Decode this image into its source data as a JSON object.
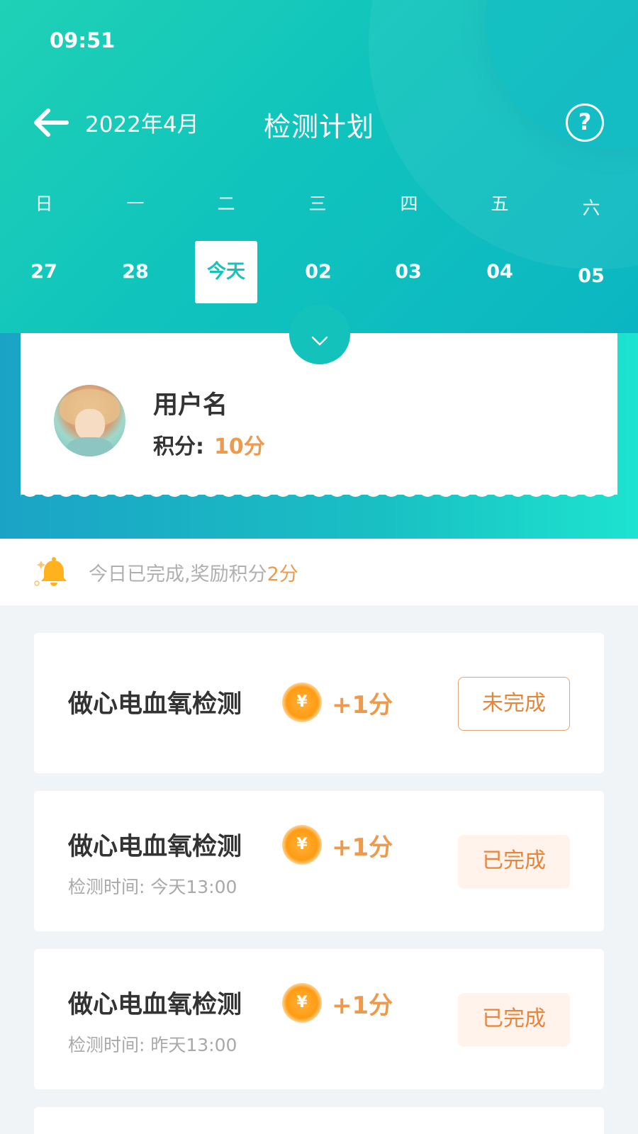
{
  "status_bar": {
    "time": "09:51"
  },
  "header": {
    "month": "2022年4月",
    "title": "检测计划",
    "help_icon": "question-circle-icon",
    "back_icon": "arrow-left-icon"
  },
  "calendar": {
    "weekdays": [
      "日",
      "一",
      "二",
      "三",
      "四",
      "五",
      "六"
    ],
    "dates": [
      "27",
      "28",
      "今天",
      "02",
      "03",
      "04",
      "05"
    ],
    "selected_index": 2
  },
  "user": {
    "name": "用户名",
    "points_label": "积分:",
    "points_value": "10分"
  },
  "notice": {
    "icon": "bell-icon",
    "text": "今日已完成,奖励积分",
    "highlight": "2分"
  },
  "tasks": [
    {
      "title": "做心电血氧检测",
      "reward": "+1分",
      "time": "",
      "status": "未完成"
    },
    {
      "title": "做心电血氧检测",
      "reward": "+1分",
      "time": "检测时间: 今天13:00",
      "status": "已完成"
    },
    {
      "title": "做心电血氧检测",
      "reward": "+1分",
      "time": "检测时间: 昨天13:00",
      "status": "已完成"
    }
  ],
  "colors": {
    "primary": "#15c3b9",
    "accent": "#ee9a4c",
    "background": "#f1f4f7"
  }
}
